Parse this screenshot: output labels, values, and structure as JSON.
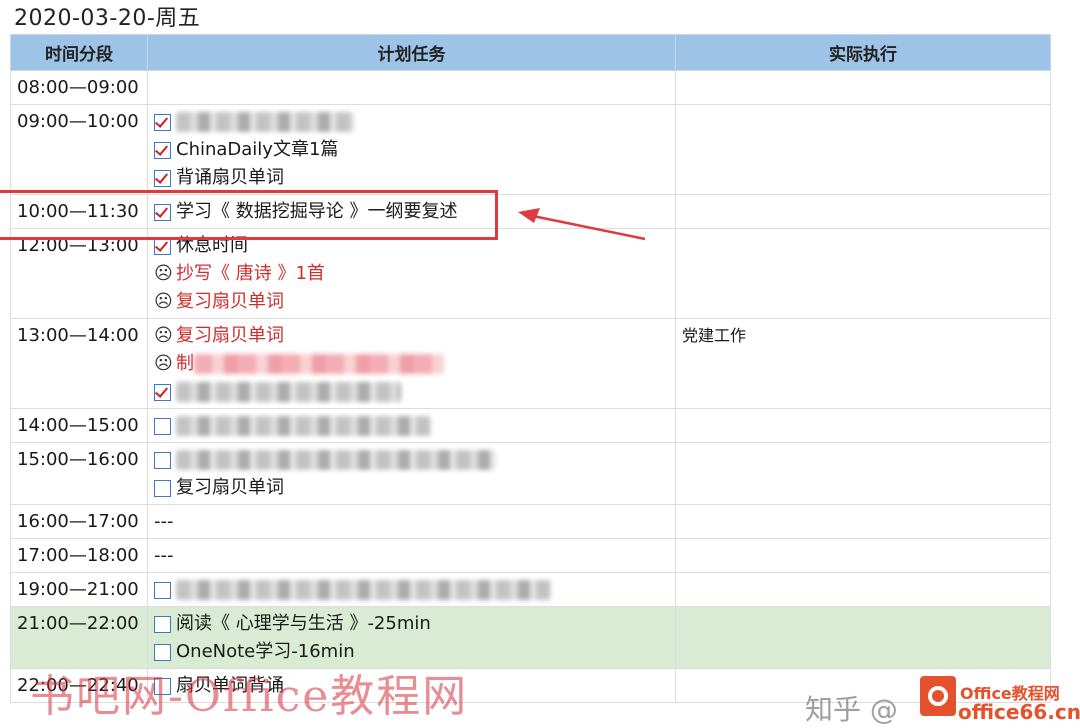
{
  "page_title": "2020-03-20-周五",
  "table": {
    "headers": [
      "时间分段",
      "计划任务",
      "实际执行"
    ],
    "rows": [
      {
        "time": "08:00—09:00",
        "tasks": [],
        "actual": ""
      },
      {
        "time": "09:00—10:00",
        "tasks": [
          {
            "state": "checked",
            "text": "",
            "blurred": true
          },
          {
            "state": "checked",
            "text": "ChinaDaily文章1篇"
          },
          {
            "state": "checked",
            "text": "背诵扇贝单词"
          }
        ],
        "actual": ""
      },
      {
        "time": "10:00—11:30",
        "tasks": [
          {
            "state": "checked",
            "text": "学习《 数据挖掘导论 》一纲要复述"
          }
        ],
        "actual": ""
      },
      {
        "time": "12:00—13:00",
        "tasks": [
          {
            "state": "checked",
            "text": "休息时间"
          },
          {
            "state": "frown",
            "text": "抄写《 唐诗 》1首"
          },
          {
            "state": "frown",
            "text": "复习扇贝单词"
          }
        ],
        "actual": ""
      },
      {
        "time": "13:00—14:00",
        "tasks": [
          {
            "state": "frown",
            "text": "复习扇贝单词"
          },
          {
            "state": "frown",
            "text": "制",
            "blurred": true
          },
          {
            "state": "checked",
            "text": "",
            "blurred": true
          }
        ],
        "actual": "党建工作"
      },
      {
        "time": "14:00—15:00",
        "tasks": [
          {
            "state": "unchecked",
            "text": "",
            "blurred": true
          }
        ],
        "actual": ""
      },
      {
        "time": "15:00—16:00",
        "tasks": [
          {
            "state": "unchecked",
            "text": "",
            "blurred": true
          },
          {
            "state": "unchecked",
            "text": "复习扇贝单词"
          }
        ],
        "actual": ""
      },
      {
        "time": "16:00—17:00",
        "tasks": [
          {
            "state": "none",
            "text": "---"
          }
        ],
        "actual": ""
      },
      {
        "time": "17:00—18:00",
        "tasks": [
          {
            "state": "none",
            "text": "---"
          }
        ],
        "actual": ""
      },
      {
        "time": "19:00—21:00",
        "tasks": [
          {
            "state": "unchecked",
            "text": "",
            "blurred": true
          }
        ],
        "actual": ""
      },
      {
        "time": "21:00—22:00",
        "highlight": "green",
        "tasks": [
          {
            "state": "unchecked",
            "text": "阅读《 心理学与生活 》-25min"
          },
          {
            "state": "unchecked",
            "text": "OneNote学习-16min"
          }
        ],
        "actual": ""
      },
      {
        "time": "22:00—22:40",
        "tasks": [
          {
            "state": "unchecked",
            "text": "扇贝单词背诵"
          }
        ],
        "actual": ""
      }
    ]
  },
  "icons": {
    "checked": "red-checkmark-checkbox-icon",
    "unchecked": "empty-checkbox-icon",
    "frown": "frowning-face-icon"
  },
  "colors": {
    "header_bg": "#9dc3e6",
    "highlight_row": "#d9ebd3",
    "annotation_red": "#e0393e",
    "task_red": "#d12c2c"
  },
  "watermarks": {
    "left": "书吧网-Office教程网",
    "zhihu": "知乎 @",
    "brand": "Office教程网",
    "site": "office66.cn"
  }
}
